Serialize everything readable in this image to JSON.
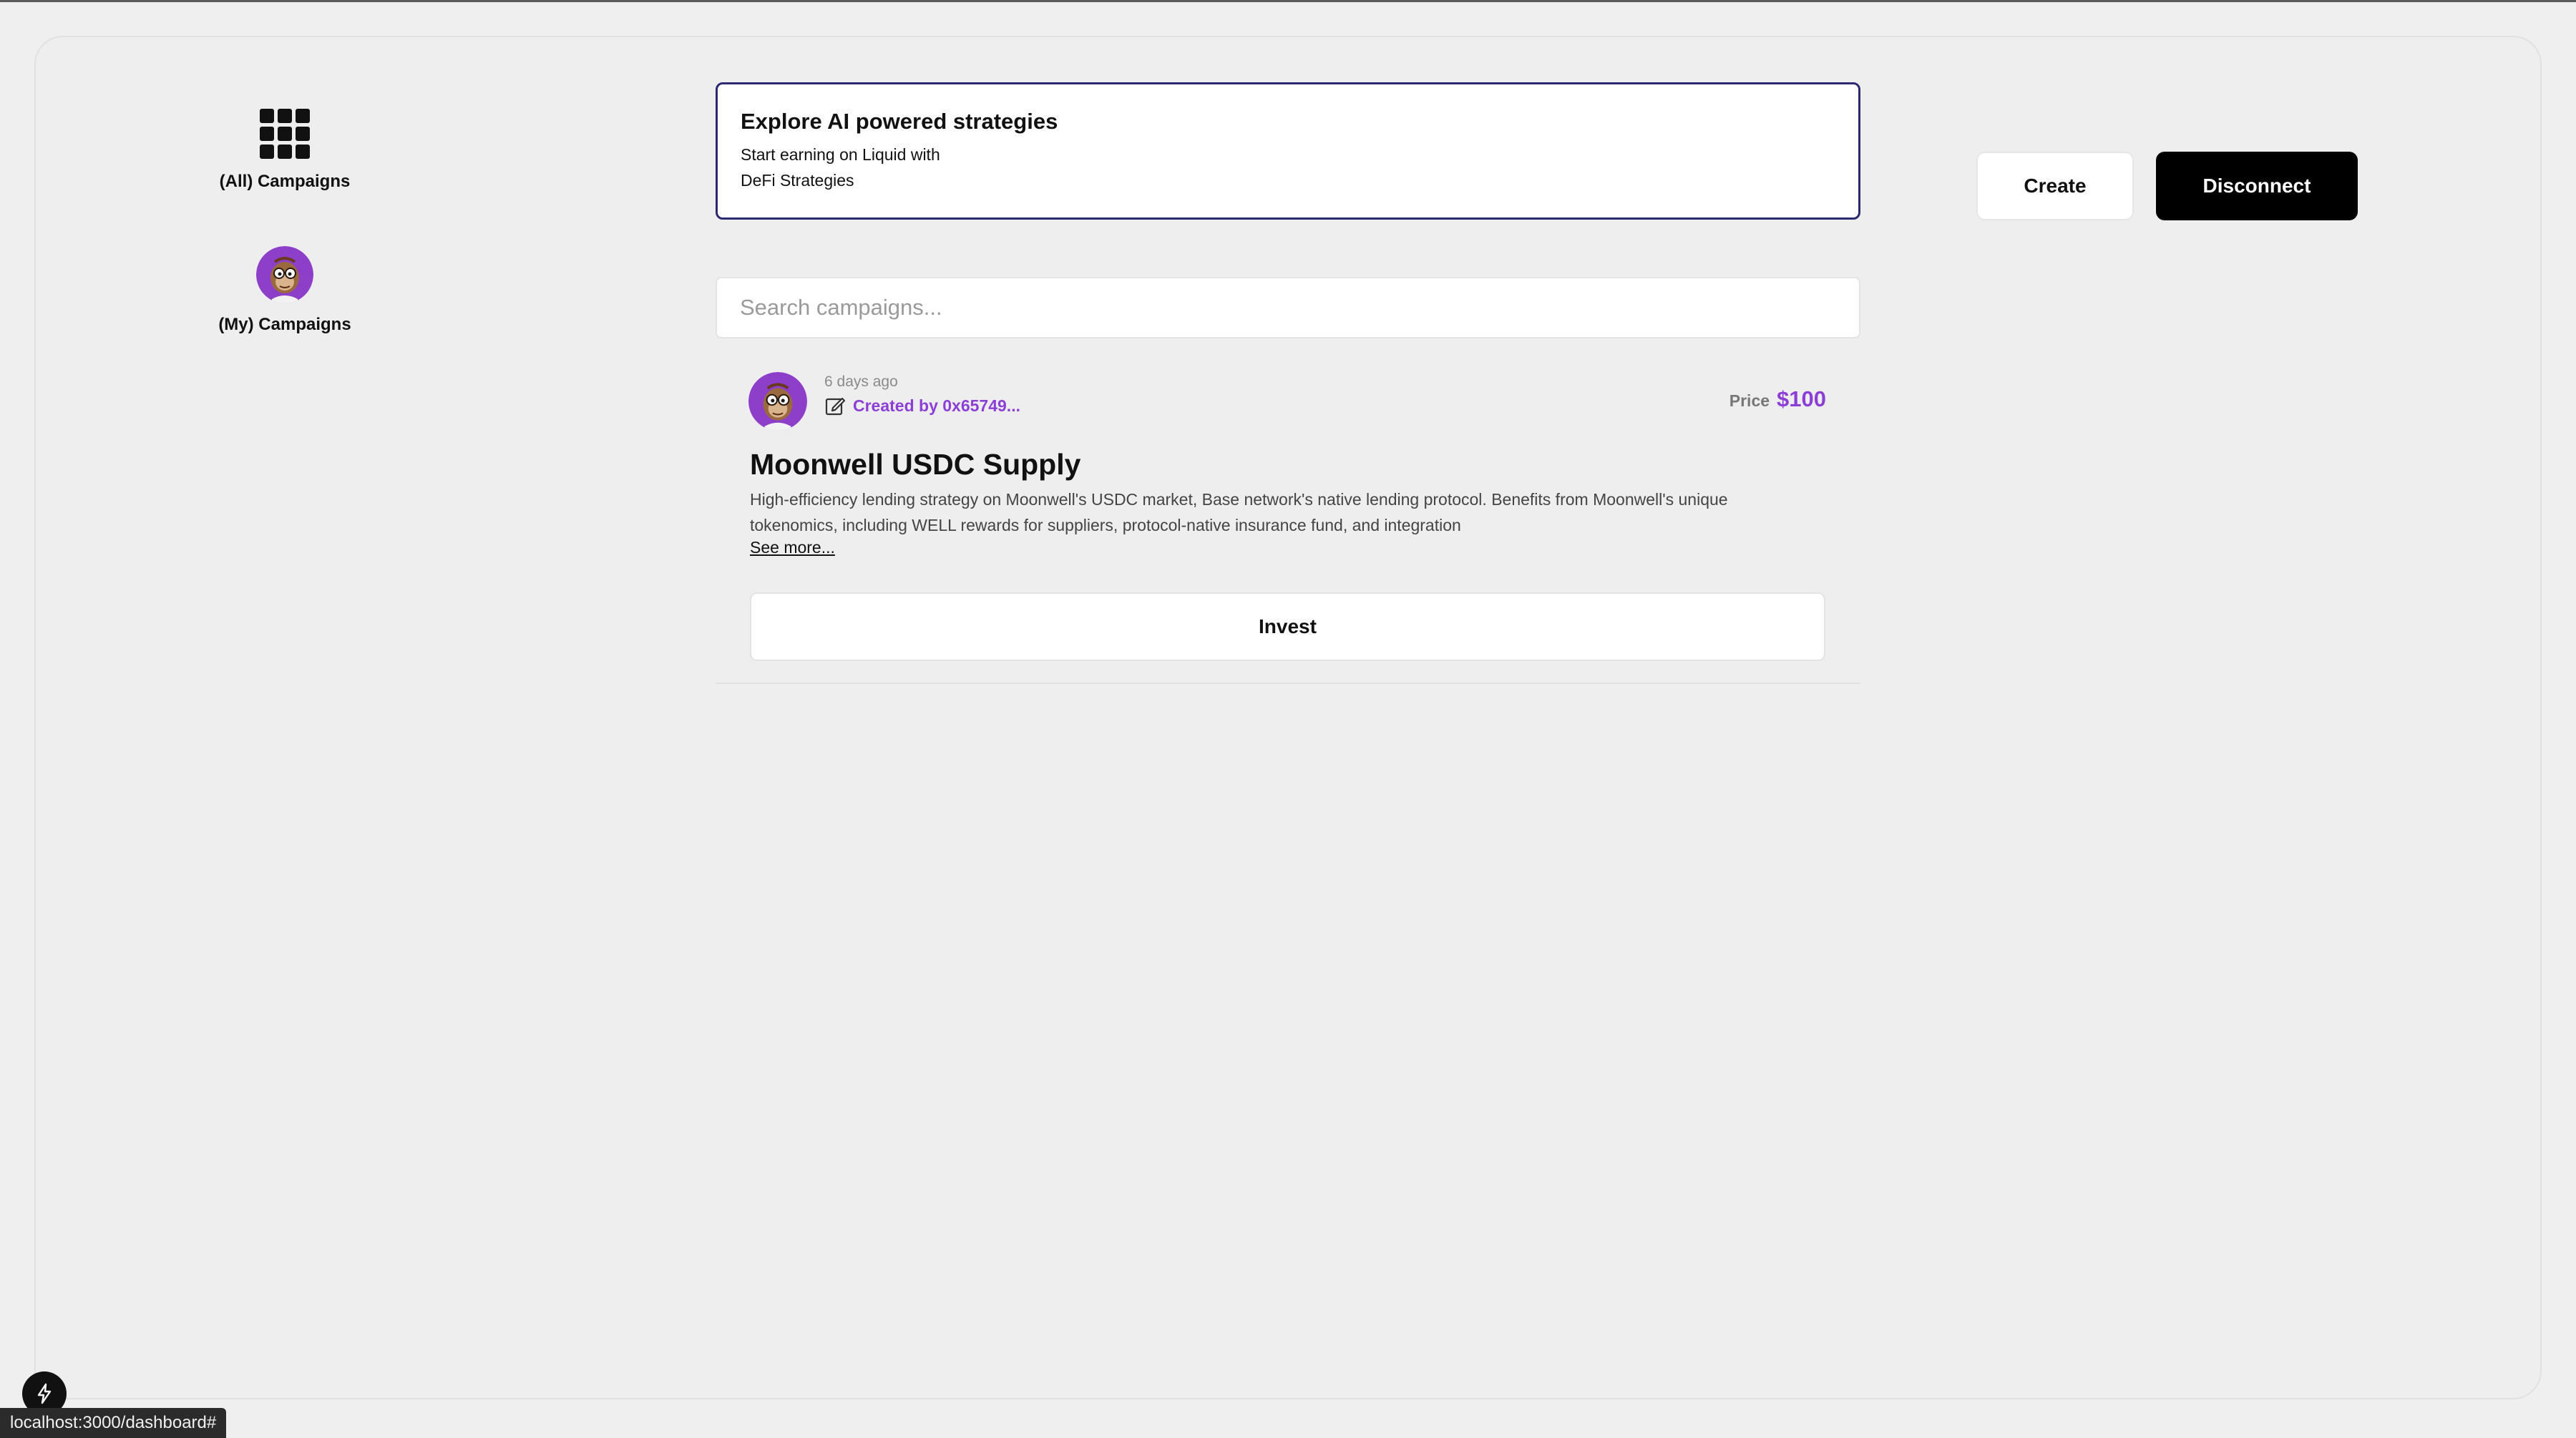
{
  "sidebar": {
    "items": [
      {
        "label": "(All) Campaigns",
        "icon": "grid-icon"
      },
      {
        "label": "(My) Campaigns",
        "icon": "avatar"
      }
    ]
  },
  "banner": {
    "title": "Explore AI powered strategies",
    "subtitle_line1": "Start earning on Liquid with",
    "subtitle_line2": "DeFi Strategies"
  },
  "header": {
    "create_label": "Create",
    "disconnect_label": "Disconnect"
  },
  "search": {
    "placeholder": "Search campaigns..."
  },
  "campaigns": [
    {
      "time_ago": "6 days ago",
      "creator": "Created by 0x65749...",
      "price_label": "Price",
      "price_value": "$100",
      "title": "Moonwell USDC Supply",
      "description": "High-efficiency lending strategy on Moonwell's USDC market, Base network's native lending protocol. Benefits from Moonwell's unique tokenomics, including WELL rewards for suppliers, protocol-native insurance fund, and integration",
      "see_more": "See more...",
      "invest_label": "Invest"
    }
  ],
  "status_bar": {
    "url": "localhost:3000/dashboard#"
  },
  "colors": {
    "accent": "#8c3fd6",
    "banner_border": "#2b2a6e",
    "primary_button": "#000000"
  }
}
